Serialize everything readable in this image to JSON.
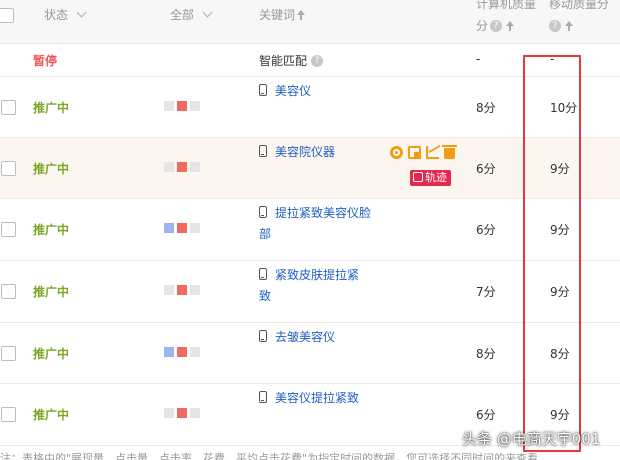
{
  "header": {
    "status_label": "状态",
    "all_label": "全部",
    "keyword_label": "关键词",
    "pc_quality_line1": "计算机质量",
    "pc_quality_line2": "分",
    "mobile_quality_line1": "移动质量分",
    "help_glyph": "?"
  },
  "smart_match_row": {
    "status": "暂停",
    "label": "智能匹配",
    "pc_score": "-",
    "mobile_score": "-"
  },
  "rows": [
    {
      "status": "推广中",
      "keyword": "美容仪",
      "pc_score": "8分",
      "mobile_score": "10分",
      "squares": [
        "#e5e5e5",
        "#f06a5f",
        "#e5e5e5"
      ]
    },
    {
      "status": "推广中",
      "keyword": "美容院仪器",
      "pc_score": "6分",
      "mobile_score": "9分",
      "squares": [
        "#e5e5e5",
        "#f06a5f",
        "#e5e5e5"
      ]
    },
    {
      "status": "推广中",
      "keyword": "提拉紧致美容仪脸部",
      "pc_score": "6分",
      "mobile_score": "9分",
      "squares": [
        "#9db4ee",
        "#f06a5f",
        "#e5e5e5"
      ]
    },
    {
      "status": "推广中",
      "keyword": "紧致皮肤提拉紧致",
      "pc_score": "7分",
      "mobile_score": "9分",
      "squares": [
        "#e5e5e5",
        "#f06a5f",
        "#e5e5e5"
      ]
    },
    {
      "status": "推广中",
      "keyword": "去皱美容仪",
      "pc_score": "8分",
      "mobile_score": "8分",
      "squares": [
        "#9db4ee",
        "#f06a5f",
        "#e5e5e5"
      ]
    },
    {
      "status": "推广中",
      "keyword": "美容仪提拉紧致",
      "pc_score": "6分",
      "mobile_score": "9分",
      "squares": [
        "#e5e5e5",
        "#f06a5f",
        "#e5e5e5"
      ]
    }
  ],
  "row_actions": {
    "icons": [
      "target-icon",
      "copy-icon",
      "trend-chart-icon",
      "trash-icon"
    ],
    "track_label": "轨迹"
  },
  "footer_note": "注：表格中的\"展现量、点击量、点击率、花费、平均点击花费\"为指定时间的数据，您可选择不同时间的来查看",
  "watermark": "头条 @电商天宇001",
  "colors": {
    "status_active": "#7ba726",
    "status_paused": "#f0565b",
    "keyword_link": "#1e5fbf",
    "highlight_box": "#e8383d",
    "action_icon": "#f39c12",
    "track_badge": "#e5294d"
  }
}
